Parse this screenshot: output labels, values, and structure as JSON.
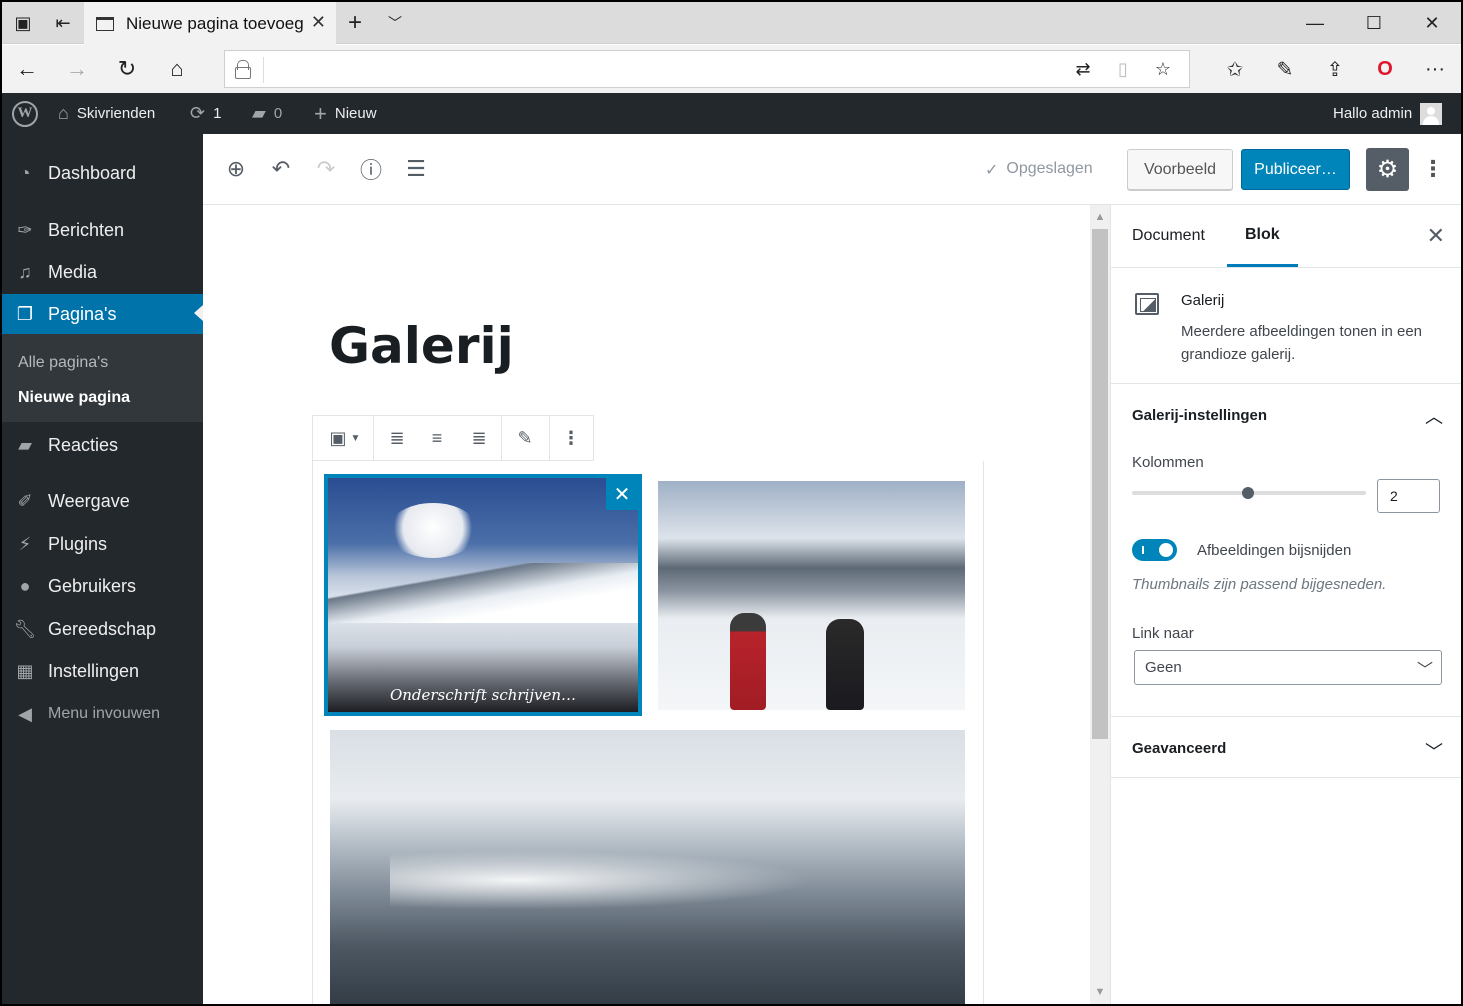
{
  "browser": {
    "tab_title": "Nieuwe pagina toevoeg",
    "url": ""
  },
  "adminbar": {
    "site_name": "Skivrienden",
    "updates_count": "1",
    "comments_count": "0",
    "new_label": "Nieuw",
    "greeting": "Hallo admin"
  },
  "sidebar": {
    "items": [
      {
        "label": "Dashboard",
        "icon": "dashboard-icon"
      },
      {
        "label": "Berichten",
        "icon": "pin-icon"
      },
      {
        "label": "Media",
        "icon": "media-icon"
      },
      {
        "label": "Pagina's",
        "icon": "pages-icon"
      },
      {
        "label": "Reacties",
        "icon": "comment-icon"
      },
      {
        "label": "Weergave",
        "icon": "brush-icon"
      },
      {
        "label": "Plugins",
        "icon": "plugin-icon"
      },
      {
        "label": "Gebruikers",
        "icon": "user-icon"
      },
      {
        "label": "Gereedschap",
        "icon": "wrench-icon"
      },
      {
        "label": "Instellingen",
        "icon": "settings-icon"
      }
    ],
    "submenu": [
      "Alle pagina's",
      "Nieuwe pagina"
    ],
    "collapse_label": "Menu invouwen"
  },
  "editor": {
    "saved_label": "Opgeslagen",
    "preview_label": "Voorbeeld",
    "publish_label": "Publiceer…",
    "page_title": "Galerij",
    "caption_placeholder": "Onderschrift schrijven…"
  },
  "inspector": {
    "tabs": [
      "Document",
      "Blok"
    ],
    "block_name": "Galerij",
    "block_description": "Meerdere afbeeldingen tonen in een grandioze galerij.",
    "gallery_settings_title": "Galerij-instellingen",
    "columns_label": "Kolommen",
    "columns_value": "2",
    "crop_label": "Afbeeldingen bijsnijden",
    "crop_help": "Thumbnails zijn passend bijgesneden.",
    "link_label": "Link naar",
    "link_value": "Geen",
    "advanced_title": "Geavanceerd"
  },
  "colors": {
    "wp_blue": "#0085ba",
    "admin_dark": "#23282d"
  }
}
